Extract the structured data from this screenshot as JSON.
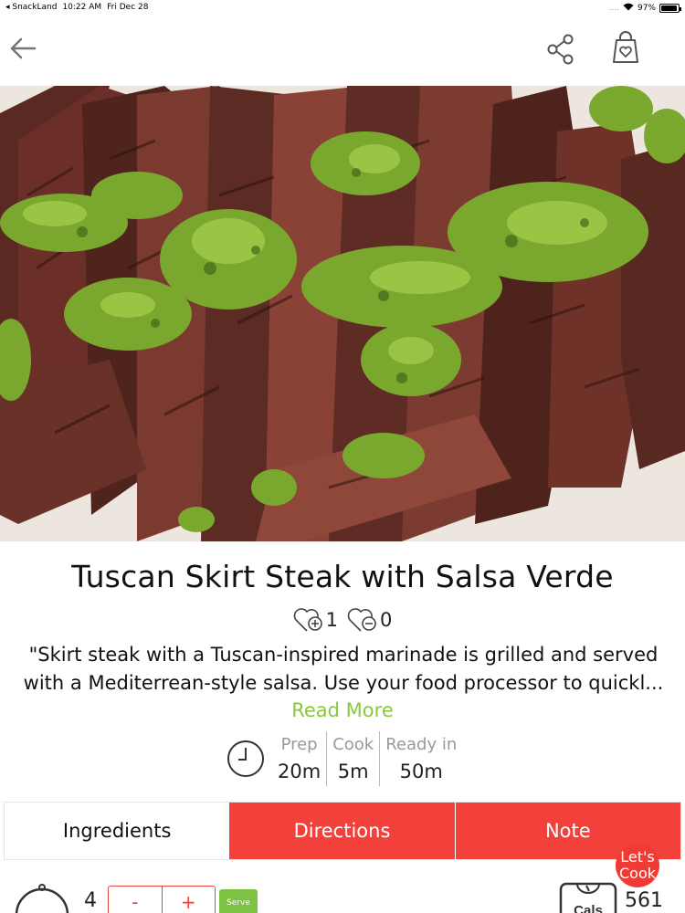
{
  "status_bar": {
    "back_app": "◂ SnackLand",
    "time": "10:22 AM",
    "date": "Fri Dec 28",
    "signal": "....",
    "wifi_icon": "wifi-icon",
    "battery_percent": "97%",
    "battery_level": 0.97
  },
  "nav": {
    "back_icon": "arrow-left-icon",
    "share_icon": "share-icon",
    "cart_icon": "shopping-bag-heart-icon"
  },
  "recipe": {
    "title": "Tuscan Skirt Steak with Salsa Verde",
    "likes": "1",
    "dislikes": "0",
    "description": "\"Skirt steak with a Tuscan-inspired marinade is grilled and served with a Mediterrean-style salsa. Use your food processor to quickl...",
    "read_more": "Read More"
  },
  "times": {
    "prep_label": "Prep",
    "prep_value": "20m",
    "cook_label": "Cook",
    "cook_value": "5m",
    "ready_label": "Ready in",
    "ready_value": "50m"
  },
  "tabs": [
    {
      "label": "Ingredients",
      "active": true
    },
    {
      "label": "Directions",
      "active": false
    },
    {
      "label": "Note",
      "active": false
    }
  ],
  "servings": {
    "count": "4",
    "minus": "-",
    "plus": "+",
    "serve_label": "Serve"
  },
  "nutrition": {
    "scale_label": "Cals",
    "calories": "561"
  },
  "lets_cook": "Let's Cook",
  "colors": {
    "accent_red": "#f2403a",
    "accent_green": "#8cc63f",
    "serve_green": "#7dc243"
  }
}
